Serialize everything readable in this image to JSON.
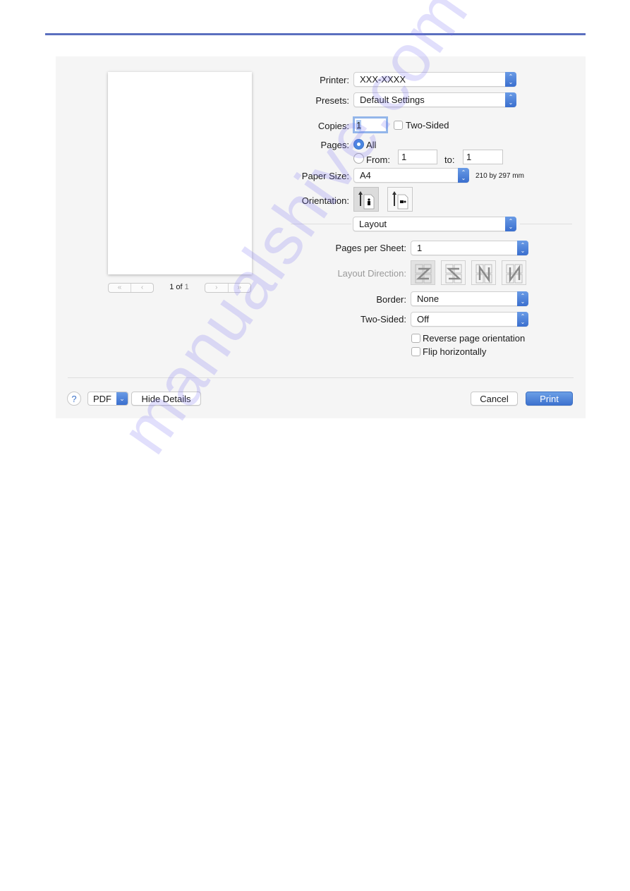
{
  "colors": {
    "accent": "#3d72cf",
    "top_rule": "#5b6fbf",
    "dialog_bg": "#f5f5f5",
    "watermark": "#c9c5f7"
  },
  "preview": {
    "page_counter_current": "1 of",
    "page_counter_total": "1",
    "nav_icons": [
      "first-page-icon",
      "previous-page-icon",
      "next-page-icon",
      "last-page-icon"
    ],
    "nav_glyphs": {
      "first": "«",
      "prev": "‹",
      "next": "›",
      "last": "»"
    }
  },
  "settings": {
    "printer": {
      "label": "Printer:",
      "value": "XXX-XXXX"
    },
    "presets": {
      "label": "Presets:",
      "value": "Default Settings"
    },
    "copies": {
      "label": "Copies:",
      "value": "1",
      "two_sided_label": "Two-Sided",
      "two_sided_checked": false
    },
    "pages": {
      "label": "Pages:",
      "all_label": "All",
      "all_selected": true,
      "from_label": "From:",
      "from_value": "1",
      "to_label": "to:",
      "to_value": "1"
    },
    "paper_size": {
      "label": "Paper Size:",
      "value": "A4",
      "dimensions": "210 by 297 mm"
    },
    "orientation": {
      "label": "Orientation:",
      "options": [
        "portrait",
        "landscape"
      ],
      "selected": "portrait"
    },
    "section_menu": {
      "value": "Layout"
    }
  },
  "layout": {
    "pages_per_sheet": {
      "label": "Pages per Sheet:",
      "value": "1"
    },
    "layout_direction": {
      "label": "Layout Direction:",
      "options": [
        "Z-order",
        "reverse-Z",
        "N-order-left",
        "N-order-right"
      ],
      "selected": "Z-order",
      "enabled": false
    },
    "border": {
      "label": "Border:",
      "value": "None"
    },
    "two_sided": {
      "label": "Two-Sided:",
      "value": "Off"
    },
    "reverse_orientation": {
      "label": "Reverse page orientation",
      "checked": false
    },
    "flip_horizontally": {
      "label": "Flip horizontally",
      "checked": false
    }
  },
  "footer": {
    "help_label": "?",
    "pdf_label": "PDF",
    "hide_details_label": "Hide Details",
    "cancel_label": "Cancel",
    "print_label": "Print"
  },
  "watermark": {
    "text": "manualshive.com"
  },
  "glyphs": {
    "stepper_up": "⌃",
    "stepper_down": "⌄",
    "chevron_down": "⌄"
  }
}
